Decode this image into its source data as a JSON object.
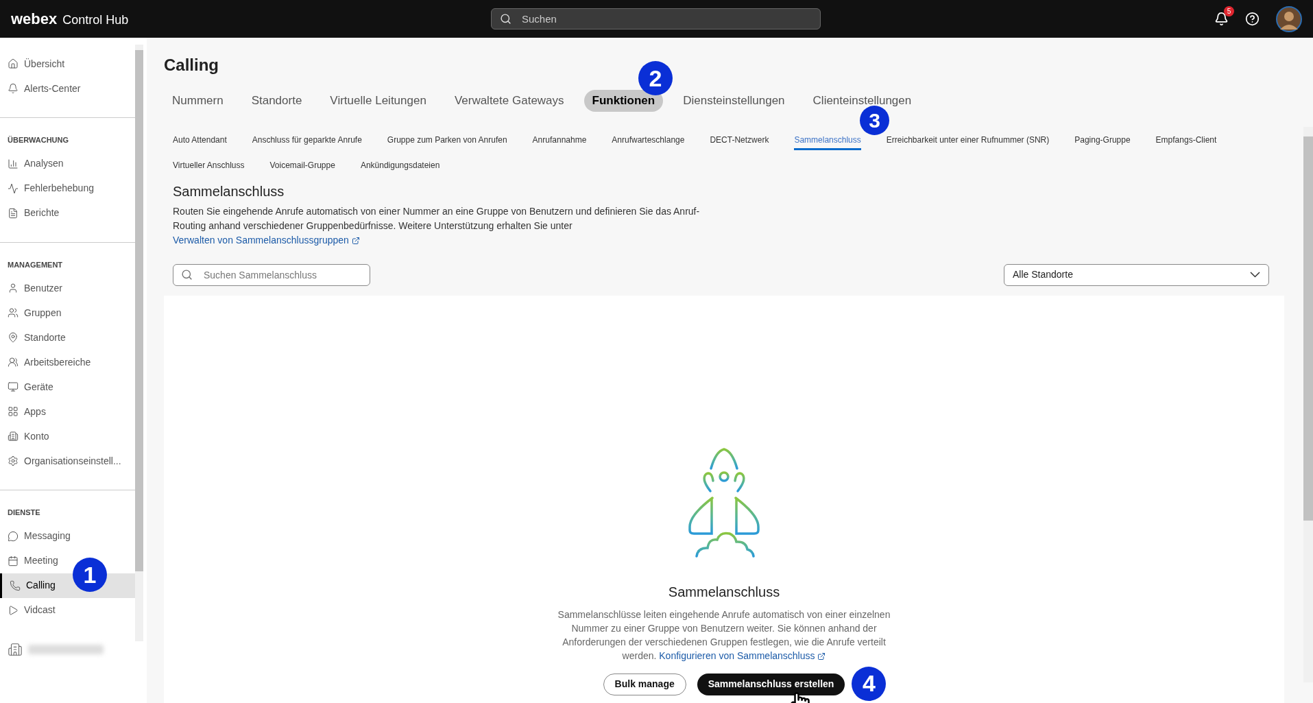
{
  "topbar": {
    "brand": "webex",
    "product": "Control Hub",
    "search_placeholder": "Suchen",
    "notification_count": "5"
  },
  "sidebar": {
    "sections": [
      {
        "items": [
          {
            "label": "Übersicht",
            "selected": false
          },
          {
            "label": "Alerts-Center",
            "selected": false
          }
        ]
      },
      {
        "heading": "ÜBERWACHUNG",
        "items": [
          {
            "label": "Analysen",
            "selected": false
          },
          {
            "label": "Fehlerbehebung",
            "selected": false
          },
          {
            "label": "Berichte",
            "selected": false
          }
        ]
      },
      {
        "heading": "MANAGEMENT",
        "items": [
          {
            "label": "Benutzer",
            "selected": false
          },
          {
            "label": "Gruppen",
            "selected": false
          },
          {
            "label": "Standorte",
            "selected": false
          },
          {
            "label": "Arbeitsbereiche",
            "selected": false
          },
          {
            "label": "Geräte",
            "selected": false
          },
          {
            "label": "Apps",
            "selected": false
          },
          {
            "label": "Konto",
            "selected": false
          },
          {
            "label": "Organisationseinstell...",
            "selected": false
          }
        ]
      },
      {
        "heading": "DIENSTE",
        "items": [
          {
            "label": "Messaging",
            "selected": false
          },
          {
            "label": "Meeting",
            "selected": false
          },
          {
            "label": "Calling",
            "selected": true
          },
          {
            "label": "Vidcast",
            "selected": false
          }
        ]
      }
    ]
  },
  "page": {
    "title": "Calling",
    "tabs": [
      {
        "label": "Nummern",
        "selected": false
      },
      {
        "label": "Standorte",
        "selected": false
      },
      {
        "label": "Virtuelle Leitungen",
        "selected": false
      },
      {
        "label": "Verwaltete Gateways",
        "selected": false
      },
      {
        "label": "Funktionen",
        "selected": true
      },
      {
        "label": "Diensteinstellungen",
        "selected": false
      },
      {
        "label": "Clienteinstellungen",
        "selected": false
      }
    ],
    "subtabs": [
      {
        "label": "Auto Attendant",
        "selected": false
      },
      {
        "label": "Anschluss für geparkte Anrufe",
        "selected": false
      },
      {
        "label": "Gruppe zum Parken von Anrufen",
        "selected": false
      },
      {
        "label": "Anrufannahme",
        "selected": false
      },
      {
        "label": "Anrufwarteschlange",
        "selected": false
      },
      {
        "label": "DECT-Netzwerk",
        "selected": false
      },
      {
        "label": "Sammelanschluss",
        "selected": true
      },
      {
        "label": "Erreichbarkeit unter einer Rufnummer (SNR)",
        "selected": false
      },
      {
        "label": "Paging-Gruppe",
        "selected": false
      },
      {
        "label": "Empfangs-Client",
        "selected": false
      },
      {
        "label": "Virtueller Anschluss",
        "selected": false
      },
      {
        "label": "Voicemail-Gruppe",
        "selected": false
      },
      {
        "label": "Ankündigungsdateien",
        "selected": false
      }
    ],
    "section_title": "Sammelanschluss",
    "section_text": "Routen Sie eingehende Anrufe automatisch von einer Nummer an eine Gruppe von Benutzern und definieren Sie das Anruf-Routing anhand verschiedener Gruppenbedürfnisse. Weitere Unterstützung erhalten Sie unter",
    "section_link": "Verwalten von Sammelanschlussgruppen",
    "search_placeholder": "Suchen Sammelanschluss",
    "location_filter": "Alle Standorte",
    "empty_title": "Sammelanschluss",
    "empty_text": "Sammelanschlüsse leiten eingehende Anrufe automatisch von einer einzelnen Nummer zu einer Gruppe von Benutzern weiter. Sie können anhand der Anforderungen der verschiedenen Gruppen festlegen, wie die Anrufe verteilt werden.",
    "empty_link": "Konfigurieren von Sammelanschluss",
    "buttons": [
      {
        "label": "Bulk manage",
        "kind": "secondary"
      },
      {
        "label": "Sammelanschluss erstellen",
        "kind": "primary"
      }
    ]
  },
  "callouts": [
    "1",
    "2",
    "3",
    "4"
  ]
}
